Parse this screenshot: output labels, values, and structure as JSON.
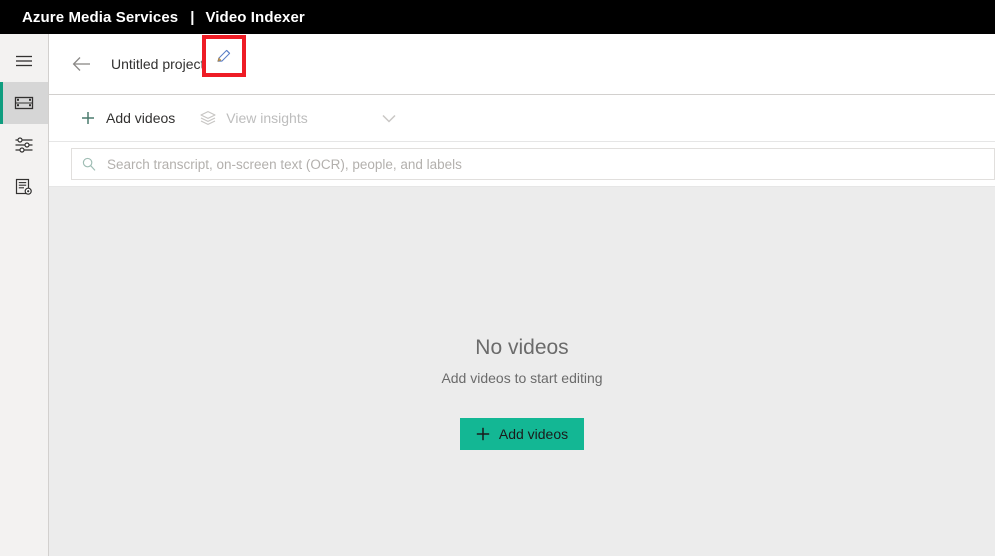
{
  "topbar": {
    "brand": "Azure Media Services",
    "separator": "|",
    "product": "Video Indexer"
  },
  "rail": {
    "items": [
      {
        "id": "menu",
        "icon": "hamburger-menu-icon",
        "label": "Menu",
        "selected": false
      },
      {
        "id": "media",
        "icon": "film-strip-icon",
        "label": "Media",
        "selected": true
      },
      {
        "id": "customization",
        "icon": "sliders-icon",
        "label": "Model customization",
        "selected": false
      },
      {
        "id": "settings",
        "icon": "document-gear-icon",
        "label": "Account settings",
        "selected": false
      }
    ],
    "selected_indicator_color": "#0f9d7f",
    "selected_background": "#d6d6d6"
  },
  "project_header": {
    "back_label": "Back",
    "title": "Untitled project",
    "edit_label": "Rename project",
    "highlight_color": "#ee1c25"
  },
  "toolbar": {
    "add_videos_label": "Add videos",
    "view_insights_label": "View insights",
    "view_insights_disabled": true,
    "chevron_label": "More"
  },
  "search": {
    "placeholder": "Search transcript, on-screen text (OCR), people, and labels",
    "value": ""
  },
  "empty_state": {
    "title": "No videos",
    "subtitle": "Add videos to start editing",
    "button_label": "Add videos",
    "button_color": "#13b794"
  }
}
